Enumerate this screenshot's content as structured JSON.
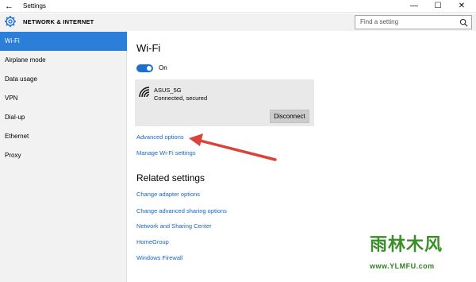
{
  "window": {
    "back_glyph": "←",
    "title": "Settings",
    "min_glyph": "—",
    "max_glyph": "☐",
    "close_glyph": "✕"
  },
  "header": {
    "title": "NETWORK & INTERNET",
    "icon": "gear-icon"
  },
  "search": {
    "placeholder": "Find a setting",
    "icon": "search-icon"
  },
  "sidebar": {
    "items": [
      {
        "label": "Wi-Fi",
        "active": true
      },
      {
        "label": "Airplane mode",
        "active": false
      },
      {
        "label": "Data usage",
        "active": false
      },
      {
        "label": "VPN",
        "active": false
      },
      {
        "label": "Dial-up",
        "active": false
      },
      {
        "label": "Ethernet",
        "active": false
      },
      {
        "label": "Proxy",
        "active": false
      }
    ]
  },
  "main": {
    "heading": "Wi-Fi",
    "toggle_label": "On",
    "network": {
      "name": "ASUS_5G",
      "status": "Connected, secured",
      "icon": "wifi-icon",
      "disconnect_label": "Disconnect"
    },
    "links": {
      "advanced": "Advanced options",
      "manage": "Manage Wi-Fi settings"
    },
    "related_heading": "Related settings",
    "related": [
      "Change adapter options",
      "Change advanced sharing options",
      "Network and Sharing Center",
      "HomeGroup",
      "Windows Firewall"
    ]
  },
  "colors": {
    "accent": "#2b7fd8",
    "link": "#1565c8",
    "arrow": "#d9443a",
    "watermark": "#3a8f2a"
  },
  "watermark": {
    "text": "雨林木风",
    "url": "www.YLMFU.com"
  }
}
